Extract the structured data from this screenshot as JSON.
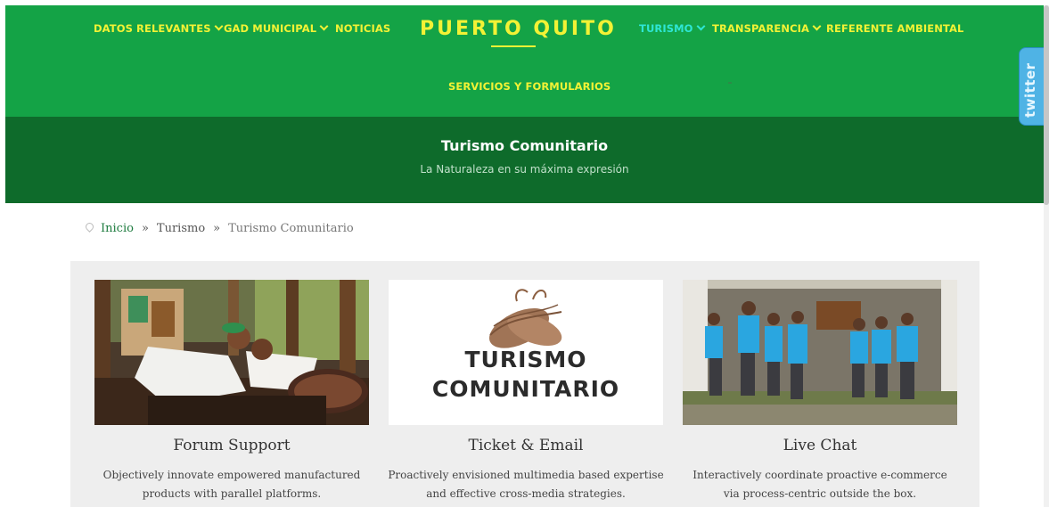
{
  "nav": {
    "left_items": [
      {
        "label": "DATOS RELEVANTES",
        "has_dropdown": true
      },
      {
        "label": "GAD MUNICIPAL",
        "has_dropdown": true
      },
      {
        "label": "NOTICIAS",
        "has_dropdown": false
      }
    ],
    "brand": "PUERTO QUITO",
    "right_items": [
      {
        "label": "TURISMO",
        "has_dropdown": true,
        "active": true
      },
      {
        "label": "TRANSPARENCIA",
        "has_dropdown": true
      },
      {
        "label": "REFERENTE AMBIENTAL",
        "has_dropdown": false
      }
    ],
    "second_row": {
      "label": "SERVICIOS Y FORMULARIOS"
    },
    "colors": {
      "background": "#14a346",
      "text": "#f2f235",
      "active_text": "#2ee6d4"
    }
  },
  "hero": {
    "title": "Turismo Comunitario",
    "subtitle": "La Naturaleza en su máxima expresión",
    "background": "#0e6b2b"
  },
  "breadcrumb": {
    "icon": "map-pin-icon",
    "items": [
      "Inicio",
      "Turismo",
      "Turismo Comunitario"
    ],
    "separator": "»"
  },
  "cards": [
    {
      "title": "Forum Support",
      "desc_line1": "Objectively innovate empowered manufactured",
      "desc_line2": "products with parallel platforms.",
      "image": "photo of two people in white clothes leaning on a table with a cacao pod"
    },
    {
      "title": "Ticket & Email",
      "desc_line1": "Proactively envisioned multimedia based expertise",
      "desc_line2": "and effective cross-media strategies.",
      "image_text_line1": "TURISMO",
      "image_text_line2": "COMUNITARIO"
    },
    {
      "title": "Live Chat",
      "desc_line1": "Interactively coordinate proactive e-commerce",
      "desc_line2": "via process-centric outside the box.",
      "image": "group photo of people in blue shirts in front of a stone wall"
    }
  ],
  "social": {
    "twitter_label": "twitter",
    "icon": "twitter-icon"
  }
}
